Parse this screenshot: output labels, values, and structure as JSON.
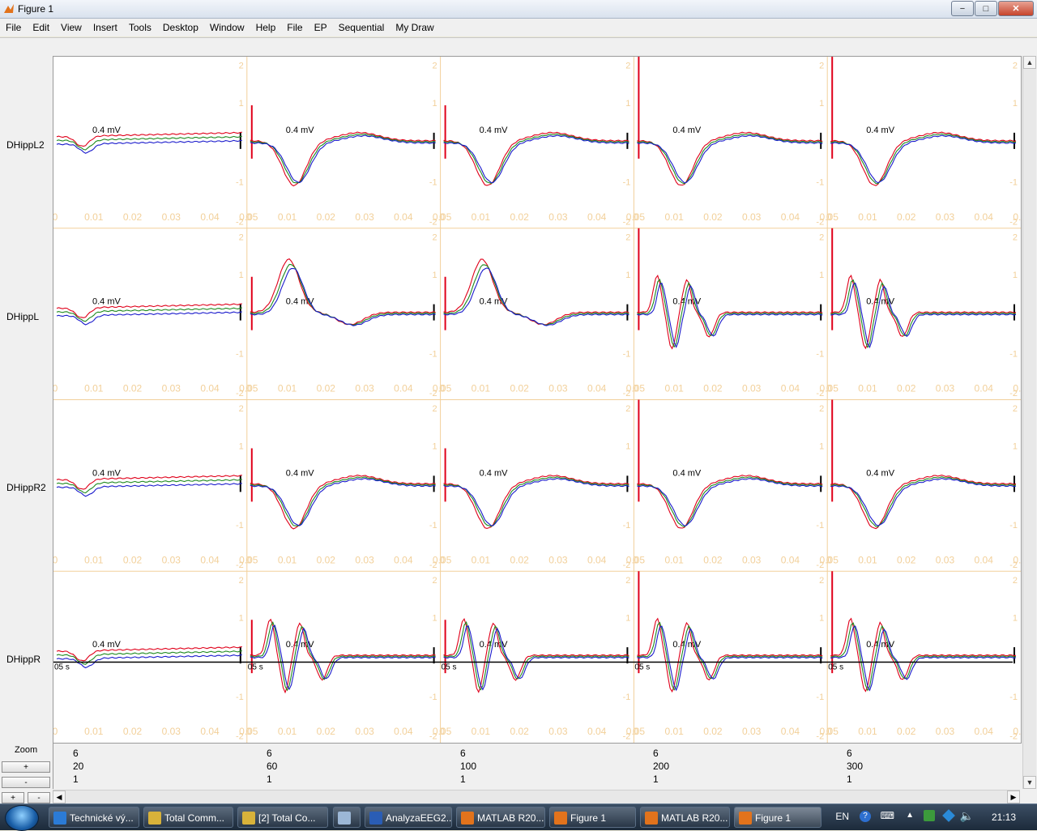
{
  "window": {
    "title": "Figure 1",
    "min": "−",
    "max": "□",
    "close": "✕"
  },
  "menu": [
    "File",
    "Edit",
    "View",
    "Insert",
    "Tools",
    "Desktop",
    "Window",
    "Help",
    "File",
    "EP",
    "Sequential",
    "My Draw"
  ],
  "rows": [
    "DHippL2",
    "DHippL",
    "DHippR2",
    "DHippR"
  ],
  "colors": {
    "red": "#e0001a",
    "green": "#1f8a1f",
    "blue": "#1a1acc",
    "axis": "#f2d09a"
  },
  "scale_label": "0.4 mV",
  "y_ticks": [
    "2",
    "1",
    "-1",
    "-2"
  ],
  "x_ticks": [
    "0",
    "0.01",
    "0.02",
    "0.03",
    "0.04",
    "0.05"
  ],
  "time_label": "05 s",
  "zoom": {
    "label": "Zoom",
    "plus": "+",
    "minus": "-"
  },
  "info": [
    {
      "a": "6",
      "b": "20",
      "c": "1"
    },
    {
      "a": "6",
      "b": "60",
      "c": "1"
    },
    {
      "a": "6",
      "b": "100",
      "c": "1"
    },
    {
      "a": "6",
      "b": "200",
      "c": "1"
    },
    {
      "a": "6",
      "b": "300",
      "c": "1"
    }
  ],
  "taskbar": [
    {
      "label": "Technické vý...",
      "color": "#2b7bd6"
    },
    {
      "label": "Total Comm...",
      "color": "#d8b23a"
    },
    {
      "label": "[2] Total Co...",
      "color": "#d8b23a"
    },
    {
      "label": "",
      "color": "#9cb7d6"
    },
    {
      "label": "AnalyzaEEG2...",
      "color": "#2a5db5"
    },
    {
      "label": "MATLAB R20...",
      "color": "#e2731c"
    },
    {
      "label": "Figure 1",
      "color": "#e2731c"
    },
    {
      "label": "MATLAB R20...",
      "color": "#e2731c"
    },
    {
      "label": "Figure 1",
      "color": "#e2731c",
      "active": true
    }
  ],
  "tray": {
    "lang": "EN",
    "time": "21:13"
  }
}
